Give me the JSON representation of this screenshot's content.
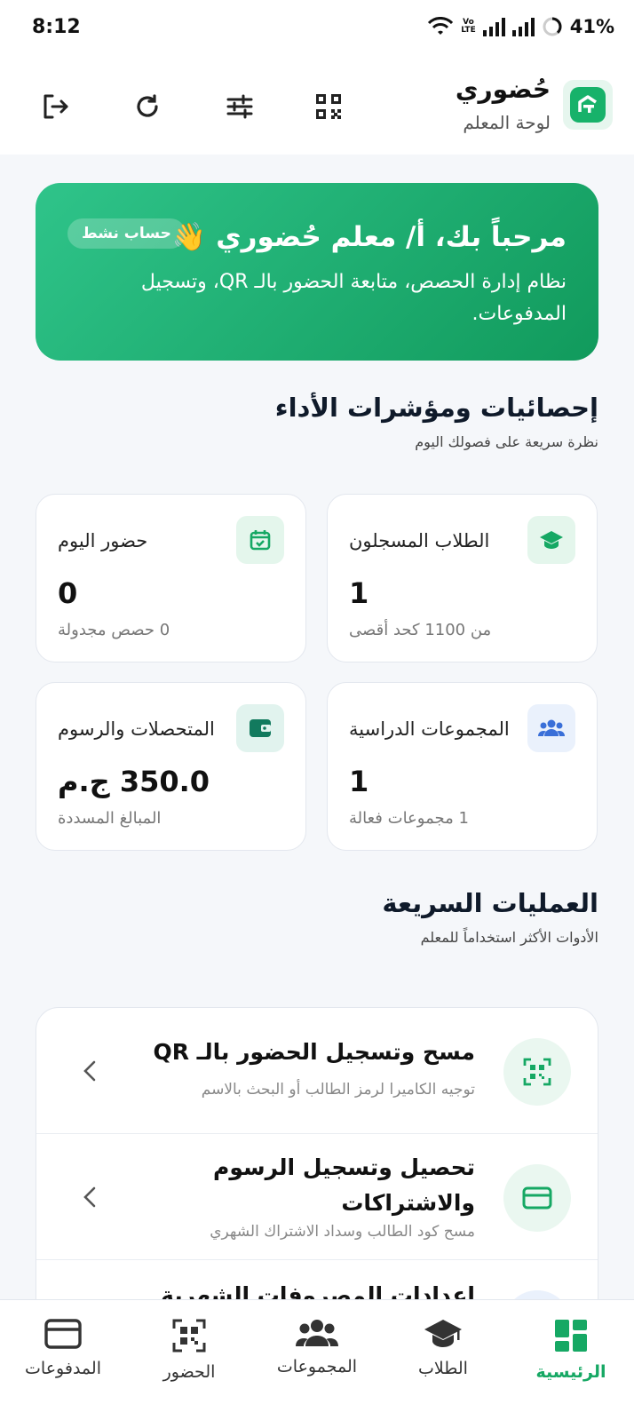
{
  "status_bar": {
    "time": "8:12",
    "battery": "41%"
  },
  "app": {
    "title": "حُضوري",
    "subtitle": "لوحة المعلم"
  },
  "hero": {
    "greeting": "مرحباً بك، أ/ معلم حُضوري 👋",
    "badge": "حساب نشط",
    "description": "نظام إدارة الحصص، متابعة الحضور بالـ QR، وتسجيل المدفوعات."
  },
  "stats_section": {
    "title": "إحصائيات ومؤشرات الأداء",
    "subtitle": "نظرة سريعة على فصولك اليوم"
  },
  "stats": [
    {
      "label": "الطلاب المسجلون",
      "value": "1",
      "sub": "من 1100 كحد أقصى",
      "icon": "graduation-cap-icon"
    },
    {
      "label": "حضور اليوم",
      "value": "0",
      "sub": "0 حصص مجدولة",
      "icon": "calendar-check-icon"
    },
    {
      "label": "المجموعات الدراسية",
      "value": "1",
      "sub": "1 مجموعات فعالة",
      "icon": "users-icon"
    },
    {
      "label": "المتحصلات والرسوم",
      "value": "350.0 ج.م",
      "sub": "المبالغ المسددة",
      "icon": "wallet-icon"
    }
  ],
  "actions_section": {
    "title": "العمليات السريعة",
    "subtitle": "الأدوات الأكثر استخداماً للمعلم"
  },
  "actions": [
    {
      "title": "مسح وتسجيل الحضور بالـ QR",
      "sub": "توجيه الكاميرا لرمز الطالب أو البحث بالاسم",
      "icon": "qr-scan-icon"
    },
    {
      "title": "تحصيل وتسجيل الرسوم والاشتراكات",
      "sub": "مسح كود الطالب وسداد الاشتراك الشهري",
      "icon": "credit-card-icon"
    },
    {
      "title": "إعدادات المصروفات الشهرية",
      "sub": "",
      "icon": "settings-icon"
    }
  ],
  "bottom_nav": [
    {
      "label": "الرئيسية",
      "icon": "dashboard-icon",
      "active": true
    },
    {
      "label": "الطلاب",
      "icon": "graduation-cap-icon",
      "active": false
    },
    {
      "label": "المجموعات",
      "icon": "users-icon",
      "active": false
    },
    {
      "label": "الحضور",
      "icon": "qr-code-icon",
      "active": false
    },
    {
      "label": "المدفوعات",
      "icon": "credit-card-icon",
      "active": false
    }
  ],
  "colors": {
    "primary": "#17b26a",
    "primary_dark": "#119a5c",
    "background": "#f5f7fa"
  }
}
